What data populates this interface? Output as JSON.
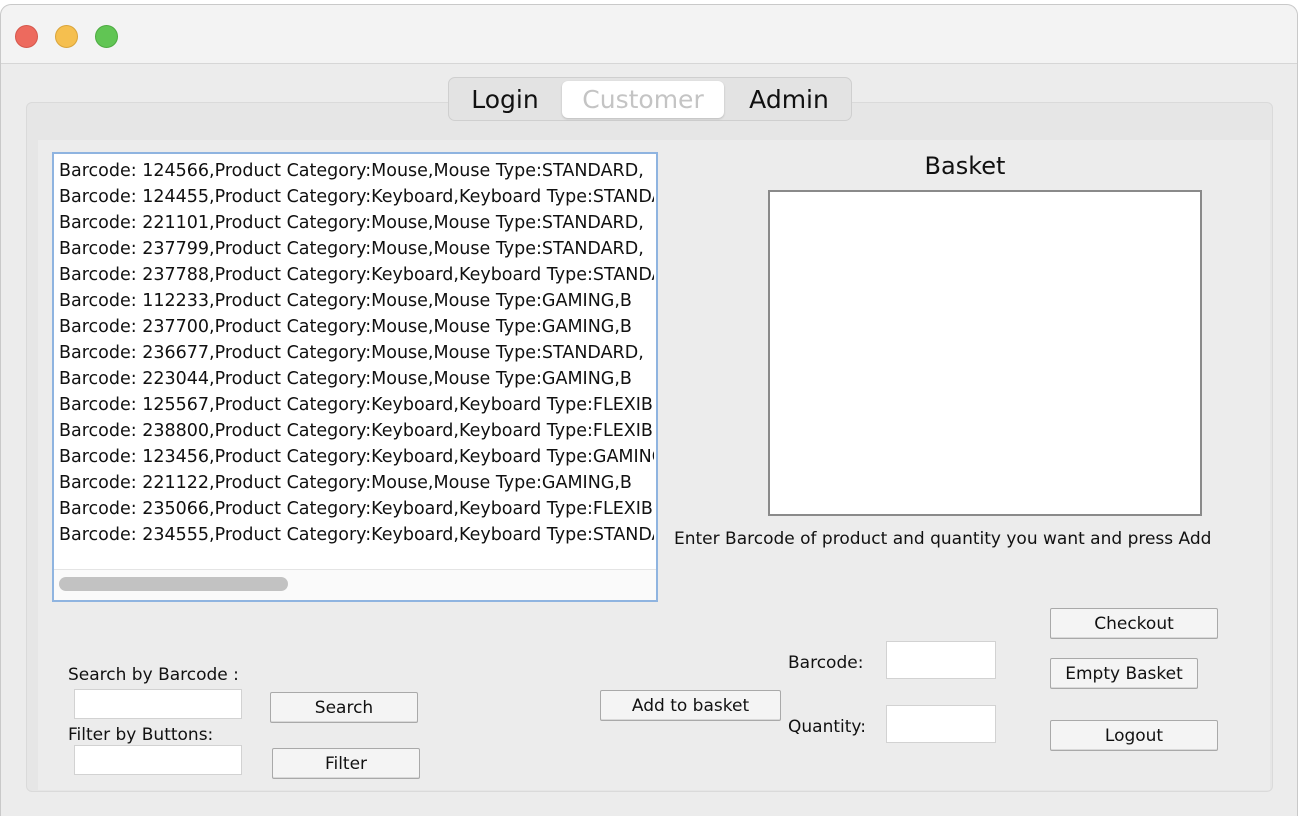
{
  "tabs": [
    {
      "label": "Login",
      "selected": false
    },
    {
      "label": "Customer",
      "selected": true
    },
    {
      "label": "Admin",
      "selected": false
    }
  ],
  "products": [
    "Barcode: 124566,Product Category:Mouse,Mouse Type:STANDARD,",
    "Barcode: 124455,Product Category:Keyboard,Keyboard Type:STANDARD,",
    "Barcode: 221101,Product Category:Mouse,Mouse Type:STANDARD,",
    "Barcode: 237799,Product Category:Mouse,Mouse Type:STANDARD,",
    "Barcode: 237788,Product Category:Keyboard,Keyboard Type:STANDARD,",
    "Barcode: 112233,Product Category:Mouse,Mouse Type:GAMING,B",
    "Barcode: 237700,Product Category:Mouse,Mouse Type:GAMING,B",
    "Barcode: 236677,Product Category:Mouse,Mouse Type:STANDARD,",
    "Barcode: 223044,Product Category:Mouse,Mouse Type:GAMING,B",
    "Barcode: 125567,Product Category:Keyboard,Keyboard Type:FLEXIBLE,",
    "Barcode: 238800,Product Category:Keyboard,Keyboard Type:FLEXIBLE,",
    "Barcode: 123456,Product Category:Keyboard,Keyboard Type:GAMING,",
    "Barcode: 221122,Product Category:Mouse,Mouse Type:GAMING,B",
    "Barcode: 235066,Product Category:Keyboard,Keyboard Type:FLEXIBLE,",
    "Barcode: 234555,Product Category:Keyboard,Keyboard Type:STANDARD,"
  ],
  "basket": {
    "title": "Basket",
    "items": [],
    "hint": "Enter Barcode of product and quantity you want and press Add"
  },
  "search": {
    "barcode_label": "Search by Barcode :",
    "barcode_value": "",
    "search_button": "Search",
    "filter_label": "Filter by Buttons:",
    "filter_value": "",
    "filter_button": "Filter"
  },
  "add": {
    "add_button": "Add to basket",
    "barcode_label": "Barcode:",
    "barcode_value": "",
    "quantity_label": "Quantity:",
    "quantity_value": ""
  },
  "actions": {
    "checkout": "Checkout",
    "empty_basket": "Empty Basket",
    "logout": "Logout"
  }
}
